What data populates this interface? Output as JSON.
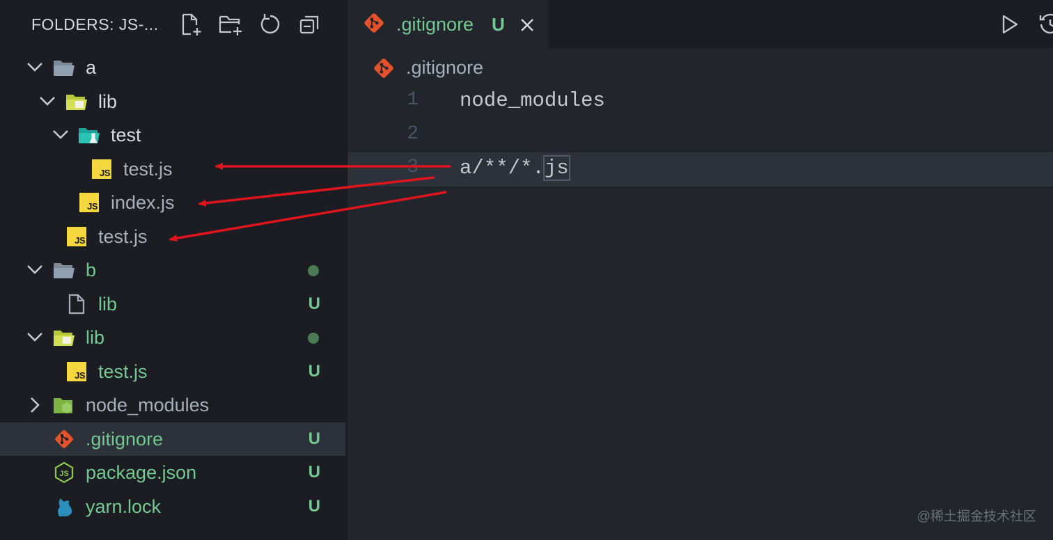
{
  "sidebar": {
    "title": "FOLDERS: JS-...",
    "actions": [
      "new-file-icon",
      "new-folder-icon",
      "refresh-icon",
      "collapse-all-icon"
    ],
    "items": [
      {
        "label": "a",
        "color": "white",
        "status": "",
        "dot": false
      },
      {
        "label": "lib",
        "color": "white",
        "status": "",
        "dot": false
      },
      {
        "label": "test",
        "color": "white",
        "status": "",
        "dot": false
      },
      {
        "label": "test.js",
        "color": "grey",
        "status": "",
        "dot": false
      },
      {
        "label": "index.js",
        "color": "grey",
        "status": "",
        "dot": false
      },
      {
        "label": "test.js",
        "color": "grey",
        "status": "",
        "dot": false
      },
      {
        "label": "b",
        "color": "green",
        "status": "",
        "dot": true
      },
      {
        "label": "lib",
        "color": "green",
        "status": "U",
        "dot": false
      },
      {
        "label": "lib",
        "color": "green",
        "status": "",
        "dot": true
      },
      {
        "label": "test.js",
        "color": "green",
        "status": "U",
        "dot": false
      },
      {
        "label": "node_modules",
        "color": "grey",
        "status": "",
        "dot": false
      },
      {
        "label": ".gitignore",
        "color": "green",
        "status": "U",
        "dot": false,
        "selected": true
      },
      {
        "label": "package.json",
        "color": "green",
        "status": "U",
        "dot": false
      },
      {
        "label": "yarn.lock",
        "color": "green",
        "status": "U",
        "dot": false
      }
    ]
  },
  "tab": {
    "label": ".gitignore",
    "status": "U"
  },
  "breadcrumb": {
    "label": ".gitignore"
  },
  "editor": {
    "lines": [
      {
        "number": "1",
        "text": "node_modules"
      },
      {
        "number": "2",
        "text": ""
      },
      {
        "number": "3",
        "text_before": "a/**/*.",
        "text_highlight": "js"
      }
    ]
  },
  "colors": {
    "sidebar_bg": "#1b1d23",
    "editor_bg": "#23252c",
    "git_untracked": "#73c991",
    "arrow": "#e0141e",
    "git_icon": "#e4522c",
    "js_badge": "#f5d73f"
  },
  "watermark": "@稀土掘金技术社区"
}
